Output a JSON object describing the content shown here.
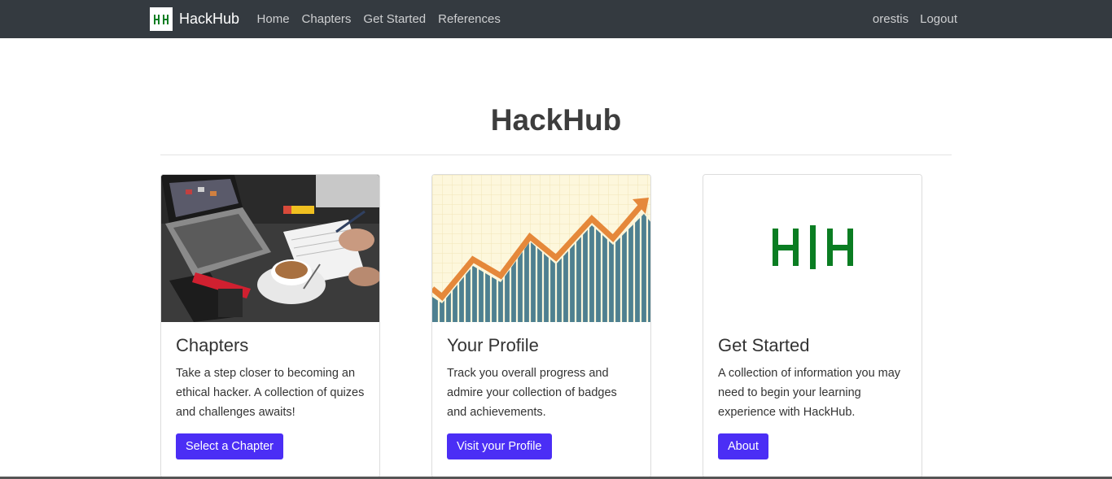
{
  "navbar": {
    "brand": "HackHub",
    "links": [
      "Home",
      "Chapters",
      "Get Started",
      "References"
    ],
    "user": "orestis",
    "logout": "Logout"
  },
  "main": {
    "title": "HackHub",
    "cards": [
      {
        "title": "Chapters",
        "text": "Take a step closer to becoming an ethical hacker. A collection of quizes and challenges awaits!",
        "button": "Select a Chapter"
      },
      {
        "title": "Your Profile",
        "text": "Track you overall progress and admire your collection of badges and achievements.",
        "button": "Visit your Profile"
      },
      {
        "title": "Get Started",
        "text": "A collection of information you may need to begin your learning experience with HackHub.",
        "button": "About"
      }
    ]
  },
  "colors": {
    "navbar_bg": "#343a40",
    "button": "#4b2ef5",
    "logo_green": "#0a7d22"
  },
  "icons": {
    "brand_logo": "hackhub-logo",
    "card3_logo": "hackhub-logo-large"
  }
}
